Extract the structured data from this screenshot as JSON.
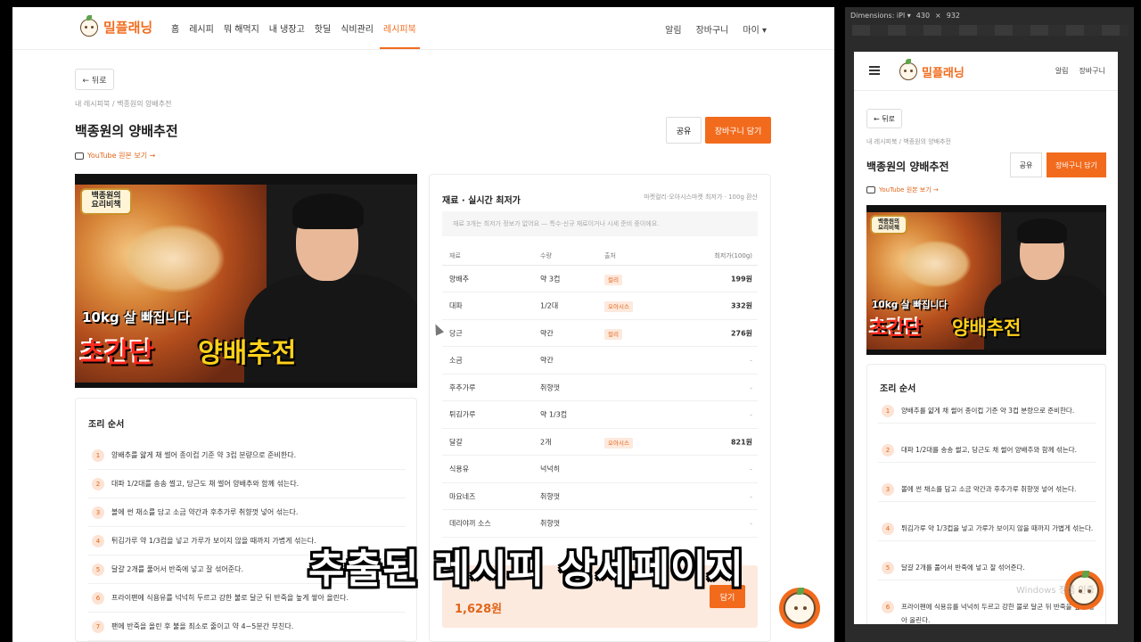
{
  "brand": {
    "name": "밀플래닝",
    "accent": "#f26b1d"
  },
  "nav": {
    "items": [
      "홈",
      "레시피",
      "뭐 해먹지",
      "내 냉장고",
      "핫딜",
      "식비관리",
      "레시피북"
    ],
    "active": "레시피북",
    "right": [
      "알림",
      "장바구니",
      "마이 ▾"
    ]
  },
  "page": {
    "back": "← 뒤로",
    "breadcrumb": "내 레시피북 / 백종원의 양배추전",
    "title": "백종원의 양배추전",
    "share": "공유",
    "add_cart": "장바구니 담기",
    "youtube_link": "YouTube 원본 보기 →"
  },
  "thumbnail": {
    "badge_line1": "백종원의",
    "badge_line2": "요리비책",
    "subtitle": "10kg 살 빠집니다",
    "headline_red": "초간단",
    "headline_yellow": "양배추전"
  },
  "ingredients": {
    "title": "재료 · 실시간 최저가",
    "note": "마켓컬리·오아시스마켓 최저가 · 100g 환산",
    "notice": "재료 3개는 최저가 정보가 없어요 — 특수·신규 재료이거나 시세 준비 중이에요.",
    "headers": [
      "재료",
      "수량",
      "출처",
      "최저가(100g)"
    ],
    "rows": [
      {
        "name": "양배추",
        "qty": "약 3컵",
        "source": "컬리",
        "price": "199원"
      },
      {
        "name": "대파",
        "qty": "1/2대",
        "source": "오아시스",
        "price": "332원"
      },
      {
        "name": "당근",
        "qty": "약간",
        "source": "컬리",
        "price": "276원"
      },
      {
        "name": "소금",
        "qty": "약간",
        "source": "",
        "price": "-"
      },
      {
        "name": "후추가루",
        "qty": "취향껏",
        "source": "",
        "price": "-"
      },
      {
        "name": "튀김가루",
        "qty": "약 1/3컵",
        "source": "",
        "price": "-"
      },
      {
        "name": "달걀",
        "qty": "2개",
        "source": "오아시스",
        "price": "821원"
      },
      {
        "name": "식용유",
        "qty": "넉넉히",
        "source": "",
        "price": "-"
      },
      {
        "name": "마요네즈",
        "qty": "취향껏",
        "source": "",
        "price": "-"
      },
      {
        "name": "데리야끼 소스",
        "qty": "취향껏",
        "source": "",
        "price": "-"
      }
    ],
    "total": "1,628원",
    "total_button": "담기"
  },
  "steps": {
    "title": "조리 순서",
    "items": [
      "양배추를 얇게 채 썰어 종이컵 기준 약 3컵 분량으로 준비한다.",
      "대파 1/2대를 송송 썰고, 당근도 채 썰어 양배추와 함께 섞는다.",
      "볼에 썬 채소를 담고 소금 약간과 후추가루 취향껏 넣어 섞는다.",
      "튀김가루 약 1/3컵을 넣고 가루가 보이지 않을 때까지 가볍게 섞는다.",
      "달걀 2개를 풀어서 반죽에 넣고 잘 섞어준다.",
      "프라이팬에 식용유를 넉넉히 두르고 강한 불로 달군 뒤 반죽을 높게 쌓아 올린다.",
      "팬에 반죽을 올린 후 불을 최소로 줄이고 약 4~5분간 부친다."
    ]
  },
  "mobile": {
    "right": [
      "알림",
      "장바구니"
    ],
    "steps": [
      "양배추를 얇게 채 썰어 종이컵 기준 약 3컵 분량으로 준비한다.",
      "대파 1/2대를 송송 썰고, 당근도 채 썰어 양배추와 함께 섞는다.",
      "볼에 썬 채소를 담고 소금 약간과 후추가루 취향껏 넣어 섞는다.",
      "튀김가루 약 1/3컵을 넣고 가루가 보이지 않을 때까지 가볍게 섞는다.",
      "달걀 2개를 풀어서 반죽에 넣고 잘 섞어준다.",
      "프라이팬에 식용유를 넉넉히 두르고 강한 불로 달군 뒤 반죽을 높게 쌓아 올린다."
    ]
  },
  "devtools": {
    "dimensions_label": "Dimensions: iPl ▾",
    "width": "430",
    "x": "×",
    "height": "932"
  },
  "caption": "추출된 레시피 상세페이지",
  "watermark": "Windows 정품 인증"
}
